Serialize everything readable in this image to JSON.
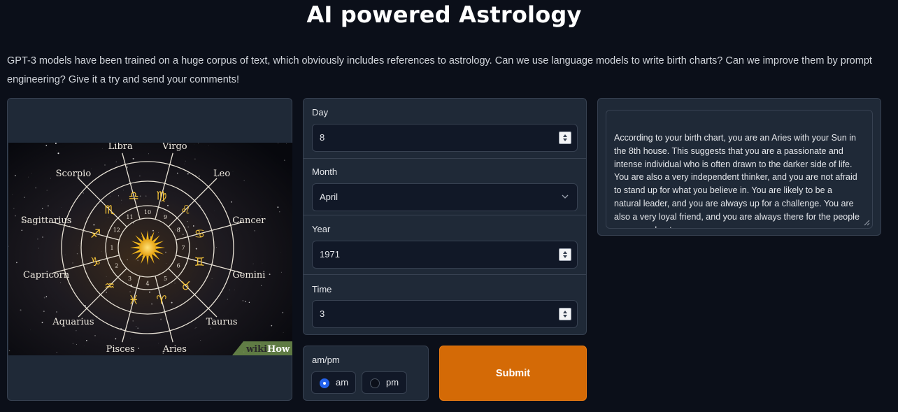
{
  "header": {
    "title": "AI powered Astrology",
    "description": "GPT-3 models have been trained on a huge corpus of text, which obviously includes references to astrology. Can we use language models to write birth charts? Can we improve them by prompt engineering? Give it a try and send your comments!"
  },
  "image": {
    "zodiac_signs": [
      "Libra",
      "Virgo",
      "Leo",
      "Cancer",
      "Gemini",
      "Taurus",
      "Aries",
      "Pisces",
      "Aquarius",
      "Capricorn",
      "Sagittarius",
      "Scorpio"
    ],
    "watermark_left": "wiki",
    "watermark_right": "How"
  },
  "form": {
    "day": {
      "label": "Day",
      "value": "8"
    },
    "month": {
      "label": "Month",
      "value": "April"
    },
    "year": {
      "label": "Year",
      "value": "1971"
    },
    "time": {
      "label": "Time",
      "value": "3"
    },
    "ampm": {
      "label": "am/pm",
      "options": [
        {
          "label": "am",
          "checked": true
        },
        {
          "label": "pm",
          "checked": false
        }
      ]
    },
    "submit_label": "Submit"
  },
  "output": {
    "text": "According to your birth chart, you are an Aries with your Sun in the 8th house. This suggests that you are a passionate and intense individual who is often drawn to the darker side of life. You are also a very independent thinker, and you are not afraid to stand up for what you believe in. You are likely to be a natural leader, and you are always up for a challenge. You are also a very loyal friend, and you are always there for the people you care about."
  },
  "colors": {
    "background": "#0b0f19",
    "panel": "#1f2937",
    "accent": "#d46a06",
    "radio_checked": "#2563eb"
  },
  "icons": [
    "chevron-down-icon",
    "spinner-icon",
    "resize-handle-icon",
    "sun-icon"
  ]
}
